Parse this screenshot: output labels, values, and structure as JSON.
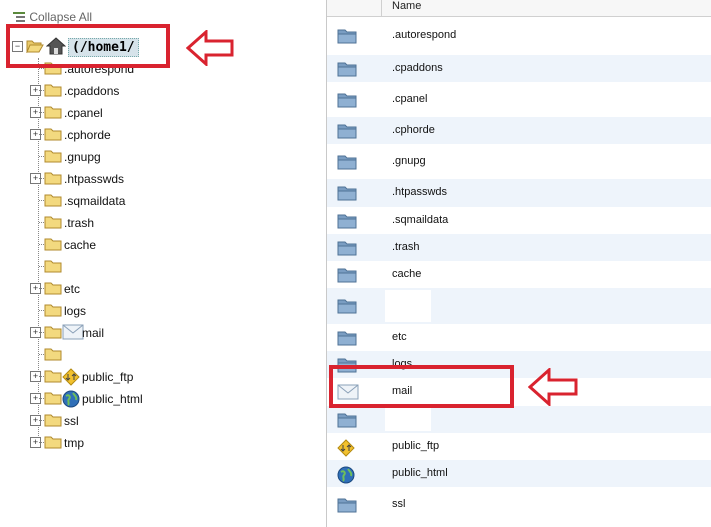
{
  "tree": {
    "collapse_all": "Collapse All",
    "root_label": "(/home1/",
    "items": [
      {
        "label": ".autorespond",
        "expandable": false
      },
      {
        "label": ".cpaddons",
        "expandable": true
      },
      {
        "label": ".cpanel",
        "expandable": true
      },
      {
        "label": ".cphorde",
        "expandable": true
      },
      {
        "label": ".gnupg",
        "expandable": false
      },
      {
        "label": ".htpasswds",
        "expandable": true
      },
      {
        "label": ".sqmaildata",
        "expandable": false
      },
      {
        "label": ".trash",
        "expandable": false
      },
      {
        "label": "cache",
        "expandable": false
      },
      {
        "label": "",
        "expandable": false
      },
      {
        "label": "etc",
        "expandable": true
      },
      {
        "label": "logs",
        "expandable": false
      },
      {
        "label": "mail",
        "expandable": true,
        "icon": "mail-icon"
      },
      {
        "label": "",
        "expandable": false
      },
      {
        "label": "public_ftp",
        "expandable": true,
        "icon": "ftp-icon"
      },
      {
        "label": "public_html",
        "expandable": true,
        "icon": "globe-icon"
      },
      {
        "label": "ssl",
        "expandable": true
      },
      {
        "label": "tmp",
        "expandable": true
      }
    ]
  },
  "files": {
    "column_name": "Name",
    "rows": [
      {
        "name": ".autorespond",
        "icon": "folder-icon"
      },
      {
        "name": ".cpaddons",
        "icon": "folder-icon"
      },
      {
        "name": ".cpanel",
        "icon": "folder-icon"
      },
      {
        "name": ".cphorde",
        "icon": "folder-icon"
      },
      {
        "name": ".gnupg",
        "icon": "folder-icon"
      },
      {
        "name": ".htpasswds",
        "icon": "folder-icon"
      },
      {
        "name": ".sqmaildata",
        "icon": "folder-icon"
      },
      {
        "name": ".trash",
        "icon": "folder-icon"
      },
      {
        "name": "cache",
        "icon": "folder-icon"
      },
      {
        "name": "",
        "icon": "folder-icon"
      },
      {
        "name": "etc",
        "icon": "folder-icon"
      },
      {
        "name": "logs",
        "icon": "folder-icon"
      },
      {
        "name": "mail",
        "icon": "mail-icon"
      },
      {
        "name": "",
        "icon": "folder-icon"
      },
      {
        "name": "public_ftp",
        "icon": "ftp-icon"
      },
      {
        "name": "public_html",
        "icon": "globe-icon"
      },
      {
        "name": "ssl",
        "icon": "folder-icon"
      }
    ]
  },
  "colors": {
    "highlight": "#d9232f",
    "row_alt": "#eef4fb",
    "folder": "#6f93b8"
  }
}
